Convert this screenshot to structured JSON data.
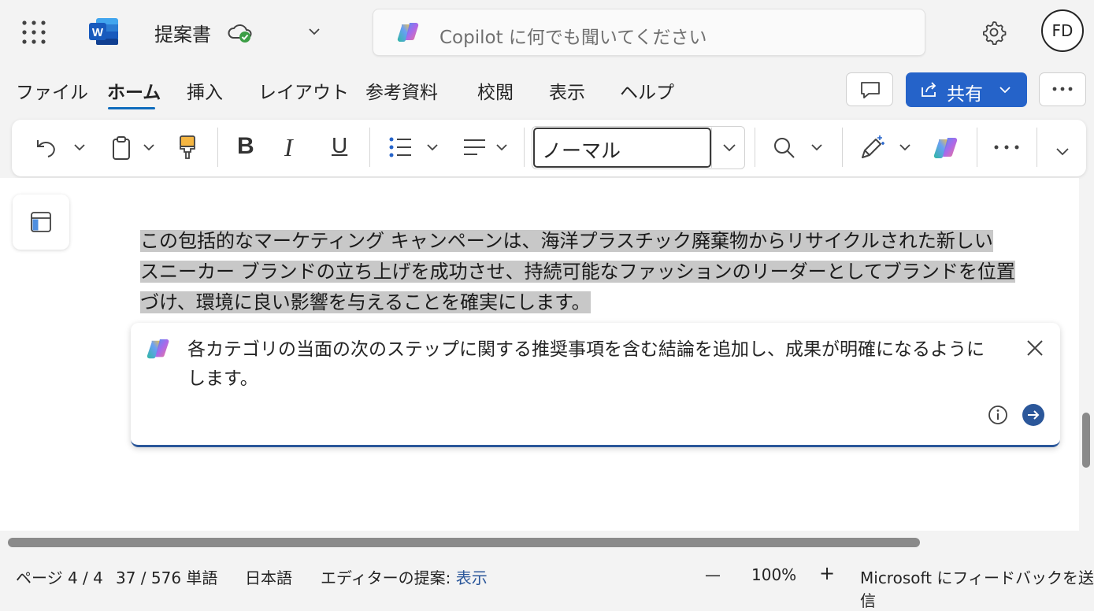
{
  "app": {
    "doc_title": "提案書",
    "search_placeholder": "Copilot に何でも聞いてください",
    "avatar_initials": "FD",
    "icons": {
      "app_launcher": "waffle-grid-icon",
      "app": "word-app-icon",
      "sync": "cloud-saved-check-icon",
      "settings": "gear-icon"
    }
  },
  "menu": {
    "tabs": [
      "ファイル",
      "ホーム",
      "挿入",
      "レイアウト",
      "参考資料",
      "校閲",
      "表示",
      "ヘルプ"
    ],
    "active_tab": "ホーム",
    "share_label": "共有"
  },
  "ribbon": {
    "style_value": "ノーマル",
    "tools": [
      "undo-icon",
      "clipboard-icon",
      "format-painter-icon",
      "bold-icon",
      "italic-icon",
      "underline-icon",
      "bullets-icon",
      "align-icon",
      "find-icon",
      "designer-pen-icon",
      "copilot-icon",
      "more-icon",
      "expand-icon"
    ],
    "bold_glyph": "B",
    "italic_glyph": "I",
    "underline_glyph": "U"
  },
  "document": {
    "paragraph_lines": [
      "この包括的なマーケティング キャンペーンは、海洋プラスチック廃棄物からリサイクルされた新しい",
      "スニーカー ブランドの立ち上げを成功させ、持続可能なファッションのリーダーとしてブランドを位置",
      "づけ、環境に良い影響を与えることを確実にします。"
    ]
  },
  "copilot": {
    "prompt_lines": [
      "各カテゴリの当面の次のステップに関する推奨事項を含む結論を追加し、成果が明確になるように",
      "します。"
    ]
  },
  "status_bar": {
    "page": "ページ 4 / 4",
    "words": "37 / 576 単語",
    "language": "日本語",
    "editor_label": "エディターの提案:",
    "editor_value": "表示",
    "zoom_minus": "—",
    "zoom": "100%",
    "zoom_plus": "+",
    "feedback": "Microsoft にフィードバックを送信"
  },
  "colors": {
    "accent": "#2563c9",
    "tab_underline": "#0f6cbd",
    "highlight": "#c8c8c8",
    "word_blue": "#185abd"
  }
}
